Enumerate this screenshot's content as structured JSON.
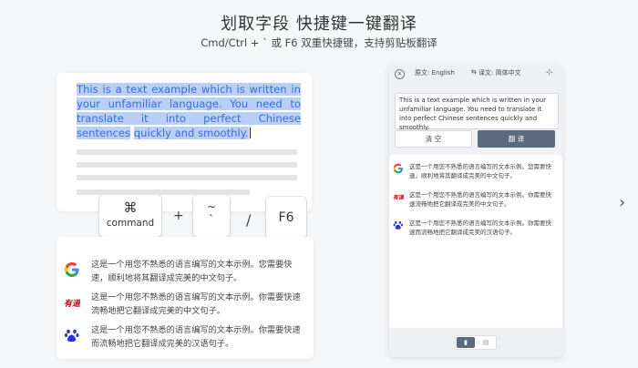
{
  "header": {
    "title": "划取字段 快捷键一键翻译",
    "subtitle": "Cmd/Ctrl + ` 或 F6 双重快捷键，支持剪贴板翻译"
  },
  "demo": {
    "sample_line1": "This is a text example which is written in",
    "sample_line2": "your unfamiliar language. You need to",
    "sample_line3": "translate it into perfect Chinese sentences",
    "sample_line4": "quickly and smoothly.",
    "highlight_color": "#b9cff4",
    "text_color": "#3b6ed0"
  },
  "keys": {
    "cmd_symbol": "⌘",
    "cmd_label": "command",
    "plus": "+",
    "tilde_top": "~",
    "tilde_bottom": "`",
    "slash": "/",
    "f6": "F6"
  },
  "results": [
    {
      "engine": "google-icon",
      "text": "这是一个用您不熟悉的语言编写的文本示例。您需要快速，顺利地将其翻译成完美的中文句子。"
    },
    {
      "engine": "youdao-icon",
      "text": "这是一个用您不熟悉的语言编写的文本示例。你需要快速流畅地把它翻译成完美的中文句子。"
    },
    {
      "engine": "baidu-icon",
      "text": "这是一个用您不熟悉的语言编写的文本示例。你需要快速而流畅地把它翻译成完美的汉语句子。"
    }
  ],
  "app": {
    "close_glyph": "×",
    "source_lang": "原文: English",
    "swap_glyph": "⇆",
    "target_lang": "译文: 简体中文",
    "pin_glyph": "⊹",
    "input_text": "This is a text example which is written in your unfamiliar language. You need to translate it into perfect Chinese sentences quickly and smoothly.",
    "clear_label": "清 空",
    "translate_label": "翻 译",
    "results": [
      {
        "engine": "google-icon",
        "text": "这是一个用您不熟悉的语言编写的文本示例。您需要快速，顺利地将其翻译成完美的中文句子。"
      },
      {
        "engine": "youdao-icon",
        "text": "这是一个用您不熟悉的语言编写的文本示例。你需要快速流畅地把它翻译成完美的中文句子。"
      },
      {
        "engine": "baidu-icon",
        "text": "这是一个用您不熟悉的语言编写的文本示例。你需要快速而流畅地把它翻译成完美的汉语句子。"
      }
    ]
  },
  "colors": {
    "accent": "#5a6a7f",
    "background": "#f6f7f9"
  },
  "nav": {
    "next_glyph": "›"
  }
}
